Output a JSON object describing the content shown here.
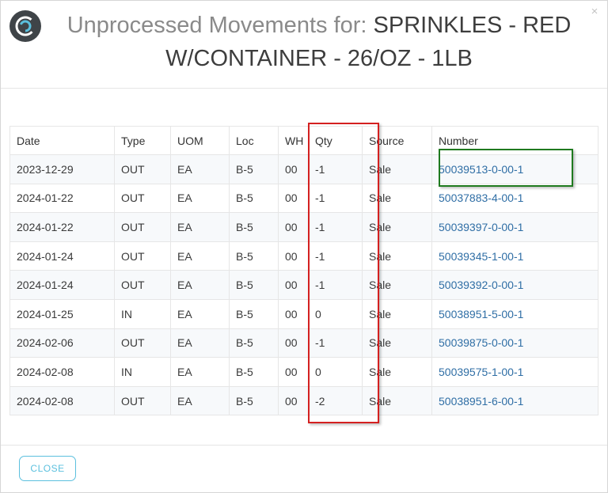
{
  "header": {
    "title_prefix": "Unprocessed Movements for: ",
    "product_name": "SPRINKLES - RED W/CONTAINER - 26/OZ - 1LB",
    "close_glyph": "×",
    "logo_icon": "app-logo-icon"
  },
  "table": {
    "columns": [
      "Date",
      "Type",
      "UOM",
      "Loc",
      "WH",
      "Qty",
      "Source",
      "Number"
    ],
    "rows": [
      {
        "date": "2023-12-29",
        "type": "OUT",
        "uom": "EA",
        "loc": "B-5",
        "wh": "00",
        "qty": "-1",
        "source": "Sale",
        "number": "50039513-0-00-1"
      },
      {
        "date": "2024-01-22",
        "type": "OUT",
        "uom": "EA",
        "loc": "B-5",
        "wh": "00",
        "qty": "-1",
        "source": "Sale",
        "number": "50037883-4-00-1"
      },
      {
        "date": "2024-01-22",
        "type": "OUT",
        "uom": "EA",
        "loc": "B-5",
        "wh": "00",
        "qty": "-1",
        "source": "Sale",
        "number": "50039397-0-00-1"
      },
      {
        "date": "2024-01-24",
        "type": "OUT",
        "uom": "EA",
        "loc": "B-5",
        "wh": "00",
        "qty": "-1",
        "source": "Sale",
        "number": "50039345-1-00-1"
      },
      {
        "date": "2024-01-24",
        "type": "OUT",
        "uom": "EA",
        "loc": "B-5",
        "wh": "00",
        "qty": "-1",
        "source": "Sale",
        "number": "50039392-0-00-1"
      },
      {
        "date": "2024-01-25",
        "type": "IN",
        "uom": "EA",
        "loc": "B-5",
        "wh": "00",
        "qty": "0",
        "source": "Sale",
        "number": "50038951-5-00-1"
      },
      {
        "date": "2024-02-06",
        "type": "OUT",
        "uom": "EA",
        "loc": "B-5",
        "wh": "00",
        "qty": "-1",
        "source": "Sale",
        "number": "50039875-0-00-1"
      },
      {
        "date": "2024-02-08",
        "type": "IN",
        "uom": "EA",
        "loc": "B-5",
        "wh": "00",
        "qty": "0",
        "source": "Sale",
        "number": "50039575-1-00-1"
      },
      {
        "date": "2024-02-08",
        "type": "OUT",
        "uom": "EA",
        "loc": "B-5",
        "wh": "00",
        "qty": "-2",
        "source": "Sale",
        "number": "50038951-6-00-1"
      }
    ]
  },
  "footer": {
    "close_label": "CLOSE"
  },
  "colors": {
    "link": "#2f6ea5",
    "qty_highlight": "#d42020",
    "number_highlight": "#1f7a1f",
    "close_button": "#5bc0de"
  }
}
